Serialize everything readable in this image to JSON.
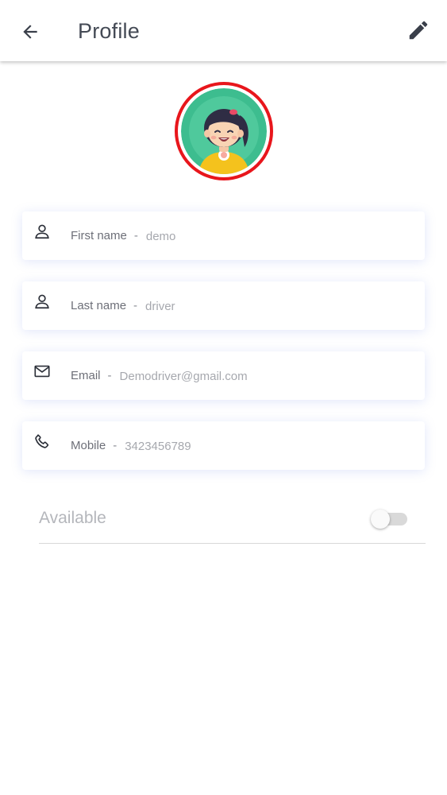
{
  "header": {
    "title": "Profile",
    "back_icon": "arrow-left-icon",
    "edit_icon": "pencil-icon"
  },
  "avatar": {
    "border_color": "#e8161c",
    "background_color": "#3dbd8f"
  },
  "fields": [
    {
      "icon": "user-icon",
      "label": "First name",
      "separator": "-",
      "value": "demo"
    },
    {
      "icon": "user-icon",
      "label": "Last name",
      "separator": "-",
      "value": "driver"
    },
    {
      "icon": "mail-icon",
      "label": "Email",
      "separator": "-",
      "value": "Demodriver@gmail.com"
    },
    {
      "icon": "phone-icon",
      "label": "Mobile",
      "separator": "-",
      "value": "3423456789"
    }
  ],
  "availability": {
    "label": "Available",
    "enabled": false
  }
}
